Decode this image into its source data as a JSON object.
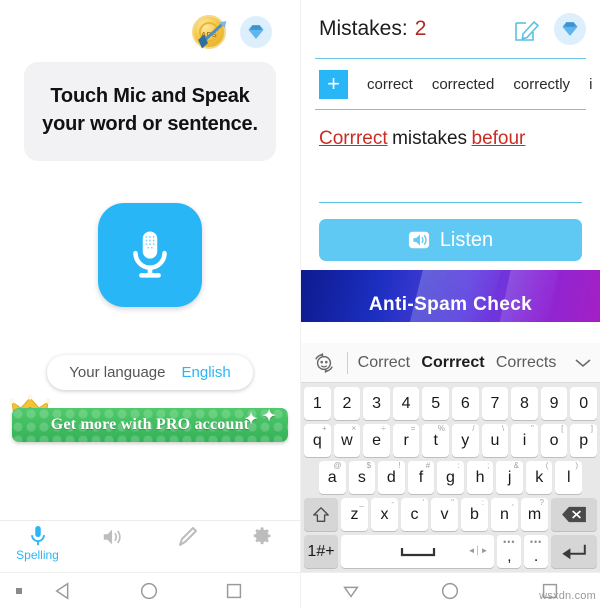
{
  "left": {
    "topbar": {
      "coin_icon": "ads-coin-icon",
      "coin_label": "ADS",
      "gem_icon": "diamond-icon"
    },
    "instruction": "Touch Mic and Speak your word or sentence.",
    "mic_icon": "microphone-icon",
    "language": {
      "label": "Your language",
      "value": "English"
    },
    "pro_banner": {
      "text": "Get more with PRO account",
      "crown_icon": "crown-icon"
    },
    "tabs": [
      {
        "label": "Spelling",
        "icon": "microphone-icon",
        "active": true
      },
      {
        "label": "",
        "icon": "speaker-icon",
        "active": false
      },
      {
        "label": "",
        "icon": "pencil-icon",
        "active": false
      },
      {
        "label": "",
        "icon": "gear-icon",
        "active": false
      }
    ],
    "navbar": {
      "back_icon": "triangle-back-icon",
      "home_icon": "circle-home-icon",
      "recents_icon": "square-recents-icon"
    }
  },
  "right": {
    "header": {
      "mistakes_label": "Mistakes:",
      "mistakes_count": "2",
      "edit_icon": "edit-pencil-icon",
      "gem_icon": "diamond-icon"
    },
    "suggestions": {
      "add_label": "+",
      "words": [
        "correct",
        "corrected",
        "correctly",
        "i"
      ]
    },
    "sentence": [
      {
        "text": "Corrrect",
        "error": true
      },
      {
        "text": "mistakes",
        "error": false
      },
      {
        "text": "befour",
        "error": true
      }
    ],
    "listen_button": {
      "label": "Listen",
      "icon": "speaker-icon"
    },
    "ad_banner": {
      "text": "Anti-Spam Check"
    },
    "keyboard": {
      "emoji_icon": "emoji-swap-icon",
      "suggestions": [
        {
          "text": "Correct",
          "bold": false
        },
        {
          "text": "Corrrect",
          "bold": true
        },
        {
          "text": "Corrects",
          "bold": false
        }
      ],
      "chevron_icon": "chevron-down-icon",
      "rows": [
        [
          {
            "main": "1",
            "sup": ""
          },
          {
            "main": "2",
            "sup": ""
          },
          {
            "main": "3",
            "sup": ""
          },
          {
            "main": "4",
            "sup": ""
          },
          {
            "main": "5",
            "sup": ""
          },
          {
            "main": "6",
            "sup": ""
          },
          {
            "main": "7",
            "sup": ""
          },
          {
            "main": "8",
            "sup": ""
          },
          {
            "main": "9",
            "sup": ""
          },
          {
            "main": "0",
            "sup": ""
          }
        ],
        [
          {
            "main": "q",
            "sup": "+"
          },
          {
            "main": "w",
            "sup": "×"
          },
          {
            "main": "e",
            "sup": "÷"
          },
          {
            "main": "r",
            "sup": "="
          },
          {
            "main": "t",
            "sup": "%"
          },
          {
            "main": "y",
            "sup": "/"
          },
          {
            "main": "u",
            "sup": "\\"
          },
          {
            "main": "i",
            "sup": "\""
          },
          {
            "main": "o",
            "sup": "["
          },
          {
            "main": "p",
            "sup": "]"
          }
        ],
        [
          {
            "main": "a",
            "sup": "@"
          },
          {
            "main": "s",
            "sup": "$"
          },
          {
            "main": "d",
            "sup": "!"
          },
          {
            "main": "f",
            "sup": "#"
          },
          {
            "main": "g",
            "sup": ":"
          },
          {
            "main": "h",
            "sup": ";"
          },
          {
            "main": "j",
            "sup": "&"
          },
          {
            "main": "k",
            "sup": "("
          },
          {
            "main": "l",
            "sup": ")"
          }
        ],
        [
          {
            "main": "z",
            "sup": "_"
          },
          {
            "main": "x",
            "sup": "-"
          },
          {
            "main": "c",
            "sup": "'"
          },
          {
            "main": "v",
            "sup": "\""
          },
          {
            "main": "b",
            "sup": ":"
          },
          {
            "main": "n",
            "sup": ","
          },
          {
            "main": "m",
            "sup": "?"
          }
        ]
      ],
      "shift_icon": "shift-icon",
      "backspace_icon": "backspace-icon",
      "symbols_key": "1#+",
      "space_key": "space-bar",
      "comma_key": ",",
      "period_key": ".",
      "enter_icon": "enter-icon"
    },
    "navbar": {
      "back_icon": "triangle-down-icon",
      "home_icon": "circle-home-icon",
      "recents_icon": "square-recents-icon"
    },
    "watermark": "wsxdn.com"
  }
}
